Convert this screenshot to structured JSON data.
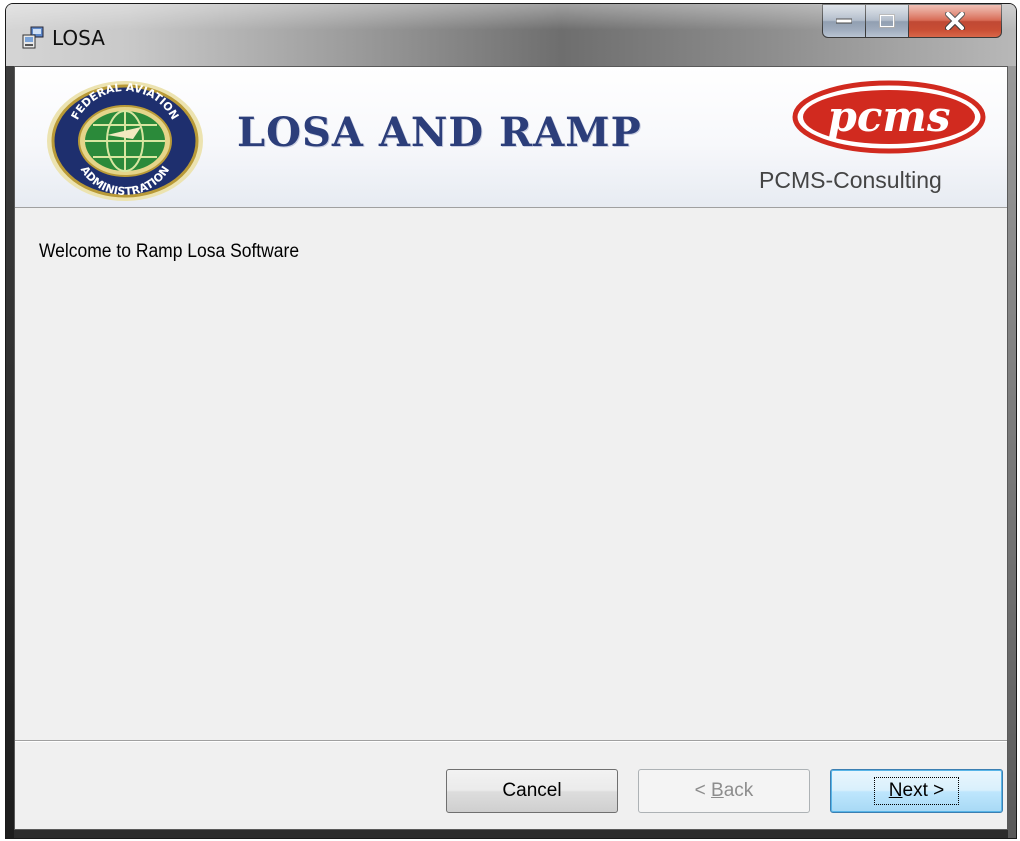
{
  "window": {
    "title": "LOSA",
    "controls": {
      "minimize": "minimize",
      "maximize": "maximize",
      "close": "close"
    }
  },
  "banner": {
    "left_logo_icon": "faa-seal-icon",
    "left_logo_text_top": "FEDERAL AVIATION",
    "left_logo_text_bottom": "ADMINISTRATION",
    "title": "LOSA AND RAMP",
    "right_logo_text": "pcms",
    "right_logo_caption": "PCMS-Consulting"
  },
  "content": {
    "welcome_text": "Welcome to Ramp Losa Software"
  },
  "buttons": {
    "cancel": "Cancel",
    "back_prefix": "< ",
    "back_mnemonic": "B",
    "back_rest": "ack",
    "next_mnemonic": "N",
    "next_rest": "ext >"
  },
  "colors": {
    "banner_title": "#2c3e7a",
    "pcms_red": "#d12a1f",
    "close_button": "#c8452a",
    "next_button_border": "#3c7fb1"
  }
}
